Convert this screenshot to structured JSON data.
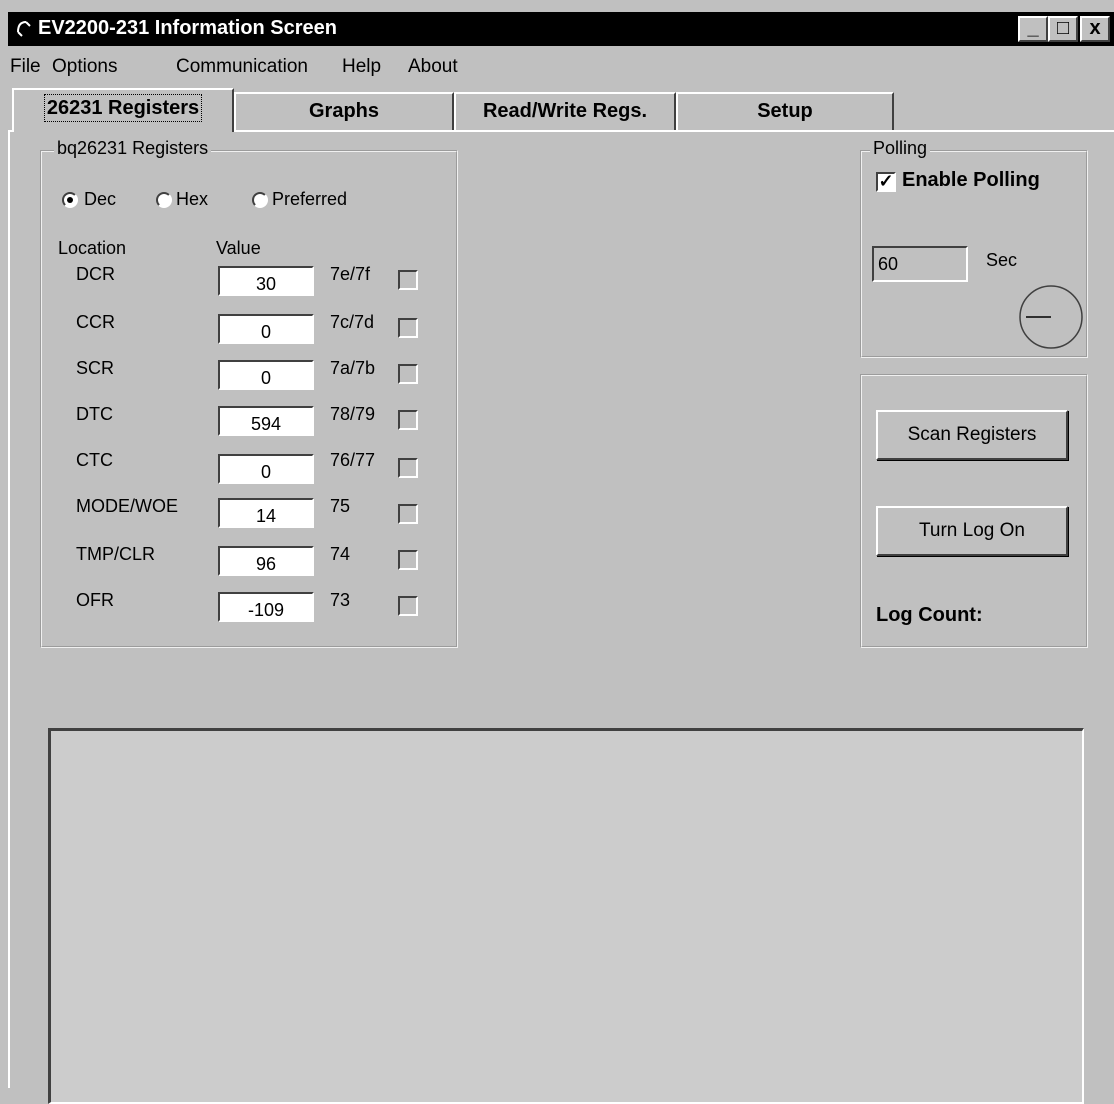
{
  "window": {
    "title": "EV2200-231 Information Screen",
    "controls": {
      "minimize": "_",
      "maximize": "□",
      "close": "x"
    }
  },
  "menu": [
    "File",
    "Options",
    "Communication",
    "Help",
    "About"
  ],
  "tabs": [
    {
      "label": "26231 Registers",
      "active": true
    },
    {
      "label": "Graphs",
      "active": false
    },
    {
      "label": "Read/Write Regs.",
      "active": false
    },
    {
      "label": "Setup",
      "active": false
    }
  ],
  "registers_group": {
    "title": "bq26231 Registers",
    "radios": [
      {
        "label": "Dec",
        "selected": true
      },
      {
        "label": "Hex",
        "selected": false
      },
      {
        "label": "Preferred",
        "selected": false
      }
    ],
    "headers": {
      "location": "Location",
      "value": "Value"
    },
    "rows": [
      {
        "name": "DCR",
        "value": "30",
        "address": "7e/7f",
        "checked": false
      },
      {
        "name": "CCR",
        "value": "0",
        "address": "7c/7d",
        "checked": false
      },
      {
        "name": "SCR",
        "value": "0",
        "address": "7a/7b",
        "checked": false
      },
      {
        "name": "DTC",
        "value": "594",
        "address": "78/79",
        "checked": false
      },
      {
        "name": "CTC",
        "value": "0",
        "address": "76/77",
        "checked": false
      },
      {
        "name": "MODE/WOE",
        "value": "14",
        "address": "75",
        "checked": false
      },
      {
        "name": "TMP/CLR",
        "value": "96",
        "address": "74",
        "checked": false
      },
      {
        "name": "OFR",
        "value": "-109",
        "address": "73",
        "checked": false
      }
    ]
  },
  "polling": {
    "title": "Polling",
    "enable_label": "Enable Polling",
    "enabled": true,
    "interval_value": "60",
    "interval_unit": "Sec"
  },
  "actions": {
    "scan_label": "Scan Registers",
    "log_label": "Turn Log On",
    "log_count_label": "Log Count:"
  },
  "colors": {
    "face": "#c0c0c0",
    "title_bar": "#000000",
    "field": "#ffffff"
  }
}
